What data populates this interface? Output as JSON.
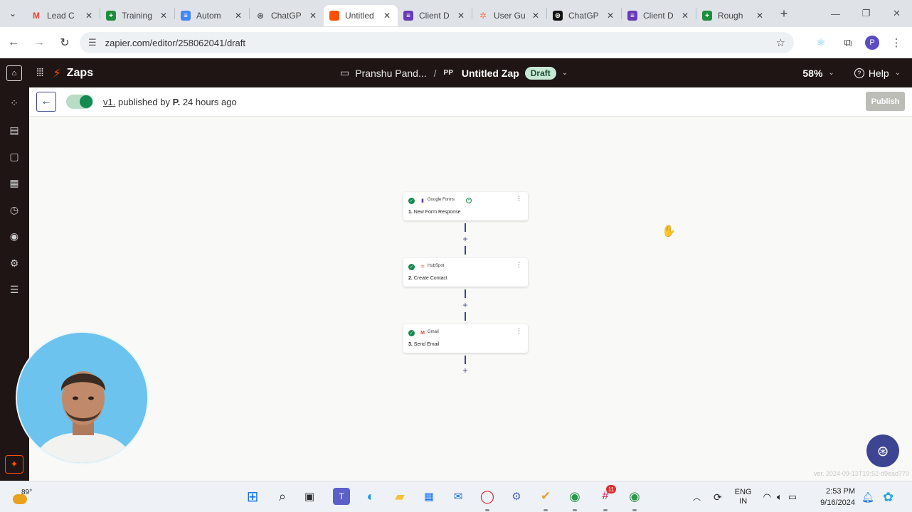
{
  "browser": {
    "tabs": [
      {
        "title": "Lead C",
        "icon": "gmail-icon",
        "color": "#ea4335",
        "active": false
      },
      {
        "title": "Training",
        "icon": "sheets-icon",
        "color": "#1e8e3e",
        "active": false
      },
      {
        "title": "Autom",
        "icon": "docs-icon",
        "color": "#4285f4",
        "active": false
      },
      {
        "title": "ChatGP",
        "icon": "chatgpt-icon",
        "color": "#555555",
        "active": false
      },
      {
        "title": "Untitled",
        "icon": "zapier-icon",
        "color": "#ff4f00",
        "active": true
      },
      {
        "title": "Client D",
        "icon": "forms-icon",
        "color": "#673ab7",
        "active": false
      },
      {
        "title": "User Gu",
        "icon": "hubspot-icon",
        "color": "#ff7a59",
        "active": false
      },
      {
        "title": "ChatGP",
        "icon": "chatgpt-icon",
        "color": "#111111",
        "active": false
      },
      {
        "title": "Client D",
        "icon": "forms-icon",
        "color": "#673ab7",
        "active": false
      },
      {
        "title": "Rough",
        "icon": "sheets-icon",
        "color": "#1e8e3e",
        "active": false
      }
    ],
    "new_tab": "+",
    "url": "zapier.com/editor/258062041/draft",
    "profile_initial": "P"
  },
  "zapier": {
    "section": "Zaps",
    "folder": "Pranshu Pand...",
    "owner_initials": "PP",
    "zap_name": "Untitled Zap",
    "status": "Draft",
    "zoom": "58%",
    "help": "Help",
    "accent": "#ff4f00"
  },
  "editor": {
    "version_link": "v1.",
    "published_text": "published by",
    "published_by": "P.",
    "published_when": "24 hours ago",
    "publish_label": "Publish"
  },
  "steps": [
    {
      "app": "Google Forms",
      "number": "1.",
      "action": "New Form Response",
      "icon": "google-forms-icon",
      "icon_color": "#673ab7"
    },
    {
      "app": "HubSpot",
      "number": "2.",
      "action": "Create Contact",
      "icon": "hubspot-icon",
      "icon_color": "#ff7a59"
    },
    {
      "app": "Gmail",
      "number": "3.",
      "action": "Send Email",
      "icon": "gmail-icon",
      "icon_color": "#ea4335"
    }
  ],
  "add_step": "+",
  "version_footer": "ver. 2024-09-13T19:52-d9ead770",
  "taskbar": {
    "temperature": "89°",
    "language": "ENG",
    "region": "IN",
    "time": "2:53 PM",
    "date": "9/16/2024",
    "slack_badge": "11"
  }
}
